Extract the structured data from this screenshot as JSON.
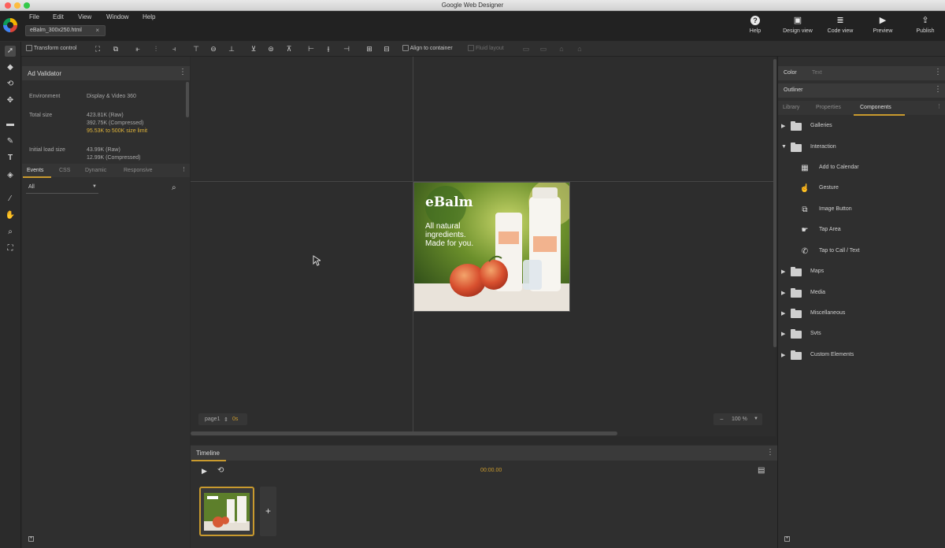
{
  "window": {
    "title": "Google Web Designer"
  },
  "menu": [
    "File",
    "Edit",
    "View",
    "Window",
    "Help"
  ],
  "file_tab": {
    "name": "eBalm_300x250.html",
    "close": "×"
  },
  "top_buttons": [
    {
      "label": "Help",
      "icon": "help-icon"
    },
    {
      "label": "Design view",
      "icon": "design-view-icon"
    },
    {
      "label": "Code view",
      "icon": "code-view-icon"
    },
    {
      "label": "Preview",
      "icon": "preview-icon"
    },
    {
      "label": "Publish",
      "icon": "publish-icon"
    }
  ],
  "toolbar": {
    "transform_control": "Transform control",
    "align_to_container": "Align to container",
    "fluid_layout": "Fluid layout"
  },
  "ad_validator": {
    "title": "Ad Validator",
    "environment_label": "Environment",
    "environment_value": "Display & Video 360",
    "total_size_label": "Total size",
    "total_size_raw": "423.81K (Raw)",
    "total_size_compressed": "392.75K (Compressed)",
    "total_size_limit": "95.53K to 500K size limit",
    "initial_load_label": "Initial load size",
    "initial_load_raw": "43.99K (Raw)",
    "initial_load_compressed": "12.99K (Compressed)"
  },
  "events_tabs": [
    "Events",
    "CSS",
    "Dynamic",
    "Responsive"
  ],
  "events_filter": "All",
  "stage": {
    "page_label": "page1",
    "page_time": "0s",
    "zoom": "100 %",
    "zoom_minus": "−",
    "ad": {
      "brand": "eBalm",
      "headline": [
        "All natural",
        "ingredients.",
        "Made for you."
      ]
    }
  },
  "right_panel": {
    "color_tabs": [
      "Color",
      "Text"
    ],
    "outliner": "Outliner",
    "lib_tabs": [
      "Library",
      "Properties",
      "Components"
    ],
    "components": [
      {
        "label": "Galleries",
        "type": "folder",
        "expanded": false
      },
      {
        "label": "Interaction",
        "type": "folder",
        "expanded": true
      },
      {
        "label": "Add to Calendar",
        "type": "item"
      },
      {
        "label": "Gesture",
        "type": "item"
      },
      {
        "label": "Image Button",
        "type": "item"
      },
      {
        "label": "Tap Area",
        "type": "item"
      },
      {
        "label": "Tap to Call / Text",
        "type": "item"
      },
      {
        "label": "Maps",
        "type": "folder",
        "expanded": false
      },
      {
        "label": "Media",
        "type": "folder",
        "expanded": false
      },
      {
        "label": "Miscellaneous",
        "type": "folder",
        "expanded": false
      },
      {
        "label": "Svts",
        "type": "folder",
        "expanded": false
      },
      {
        "label": "Custom Elements",
        "type": "folder",
        "expanded": false
      }
    ]
  },
  "timeline": {
    "title": "Timeline",
    "time": "00:00.00"
  },
  "colors": {
    "accent": "#c99a2e",
    "bg": "#2d2d2d",
    "panel": "#2f2f2f"
  }
}
